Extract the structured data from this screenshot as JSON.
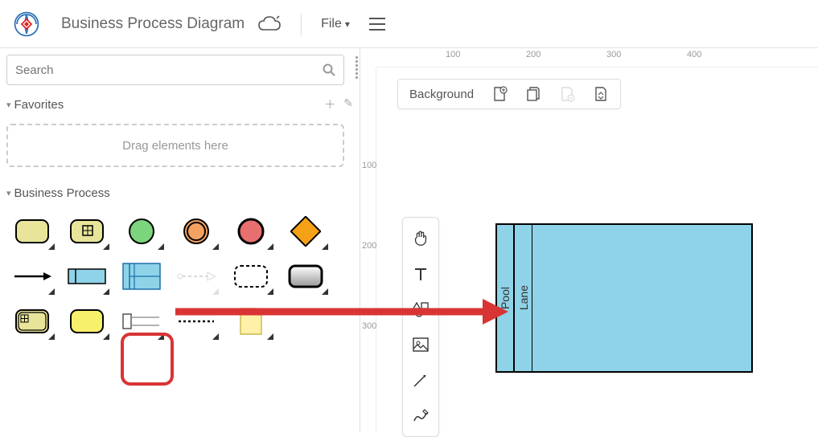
{
  "header": {
    "title": "Business Process Diagram",
    "file_menu": "File"
  },
  "sidebar": {
    "search_placeholder": "Search",
    "favorites_title": "Favorites",
    "drag_hint": "Drag elements here",
    "palette_title": "Business Process"
  },
  "canvas": {
    "context_label": "Background",
    "ruler_h": [
      "100",
      "200",
      "300",
      "400"
    ],
    "ruler_v": [
      "100",
      "200",
      "300"
    ],
    "pool_label": "Pool",
    "lane_label": "Lane"
  }
}
